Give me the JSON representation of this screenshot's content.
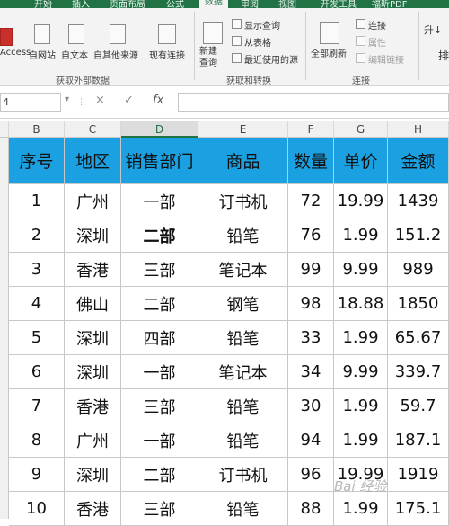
{
  "ribbon_tabs": [
    "开始",
    "插入",
    "页面布局",
    "公式",
    "数据",
    "审阅",
    "视图",
    "开发工具",
    "福昕PDF"
  ],
  "active_tab": "数据",
  "ribbon": {
    "access": "Access",
    "from_web": "自网站",
    "from_text": "自文本",
    "from_other": "自其他来源",
    "existing_conn": "现有连接",
    "group_external": "获取外部数据",
    "new_query": "新建\n查询",
    "show_queries": "显示查询",
    "from_table": "从表格",
    "recent_sources": "最近使用的源",
    "group_transform": "获取和转换",
    "refresh_all": "全部刷新",
    "connections": "连接",
    "properties": "属性",
    "edit_links": "编辑链接",
    "group_conn": "连接",
    "sort_az": "升↓",
    "sort": "排"
  },
  "formula_bar": {
    "namebox": "4",
    "fx": "fx",
    "cancel": "×",
    "enter": "✓"
  },
  "columns": [
    "B",
    "C",
    "D",
    "E",
    "F",
    "G",
    "H"
  ],
  "selected_column": "D",
  "table": {
    "headers": [
      "序号",
      "地区",
      "销售部门",
      "商品",
      "数量",
      "单价",
      "金额"
    ],
    "rows": [
      [
        "1",
        "广州",
        "一部",
        "订书机",
        "72",
        "19.99",
        "1439"
      ],
      [
        "2",
        "深圳",
        "二部",
        "铅笔",
        "76",
        "1.99",
        "151.2"
      ],
      [
        "3",
        "香港",
        "三部",
        "笔记本",
        "99",
        "9.99",
        "989"
      ],
      [
        "4",
        "佛山",
        "二部",
        "钢笔",
        "98",
        "18.88",
        "1850"
      ],
      [
        "5",
        "深圳",
        "四部",
        "铅笔",
        "33",
        "1.99",
        "65.67"
      ],
      [
        "6",
        "深圳",
        "一部",
        "笔记本",
        "34",
        "9.99",
        "339.7"
      ],
      [
        "7",
        "香港",
        "三部",
        "铅笔",
        "30",
        "1.99",
        "59.7"
      ],
      [
        "8",
        "广州",
        "一部",
        "铅笔",
        "94",
        "1.99",
        "187.1"
      ],
      [
        "9",
        "深圳",
        "二部",
        "订书机",
        "96",
        "19.99",
        "1919"
      ],
      [
        "10",
        "香港",
        "三部",
        "铅笔",
        "88",
        "1.99",
        "175.1"
      ]
    ]
  },
  "watermark": "Bai 经验",
  "colors": {
    "header_fill": "#1ba1e2",
    "ribbon_green": "#217346"
  }
}
